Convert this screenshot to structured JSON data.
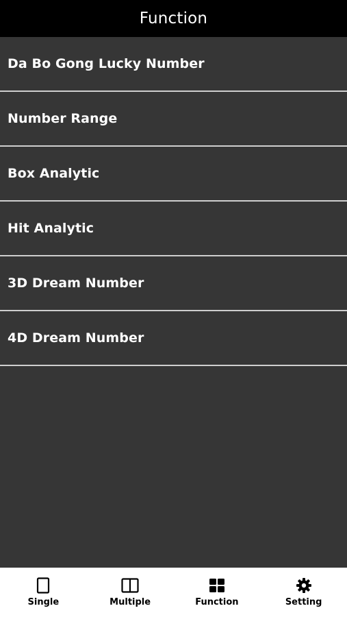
{
  "header": {
    "title": "Function"
  },
  "menu": {
    "items": [
      {
        "label": "Da Bo Gong Lucky Number"
      },
      {
        "label": "Number Range"
      },
      {
        "label": "Box Analytic"
      },
      {
        "label": "Hit Analytic"
      },
      {
        "label": "3D Dream Number"
      },
      {
        "label": "4D Dream Number"
      }
    ]
  },
  "tabbar": {
    "tabs": [
      {
        "label": "Single",
        "icon": "single-page-icon"
      },
      {
        "label": "Multiple",
        "icon": "multiple-page-icon"
      },
      {
        "label": "Function",
        "icon": "grid-icon",
        "active": true
      },
      {
        "label": "Setting",
        "icon": "gear-icon"
      }
    ]
  },
  "colors": {
    "background": "#363636",
    "header": "#000000",
    "divider": "#cfcfcf",
    "tabbar": "#ffffff",
    "text_light": "#ffffff",
    "text_dark": "#000000"
  }
}
